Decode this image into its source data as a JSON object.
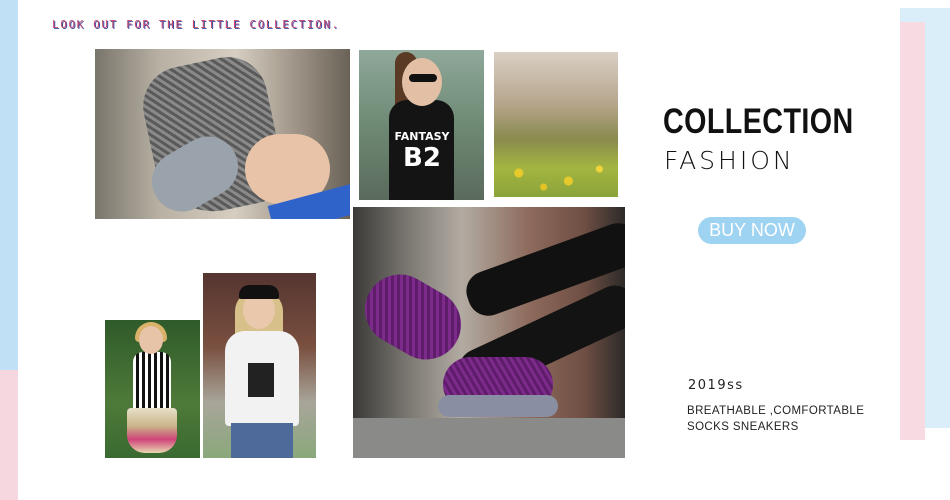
{
  "banner": {
    "tagline": "LOOK OUT FOR THE LITTLE COLLECTION.",
    "title": "COLLECTION",
    "subtitle": "FASHION",
    "cta_label": "BUY NOW",
    "season": "2019ss",
    "description_line1": "BREATHABLE ,COMFORTABLE",
    "description_line2": "SOCKS SNEAKERS"
  },
  "photos": {
    "fantasy_shirt_text1": "FANTASY",
    "fantasy_shirt_text2": "B2"
  },
  "colors": {
    "accent_blue": "#9ed3f1",
    "accent_pink": "#f8dbe2",
    "tagline_pink": "#c44a70"
  }
}
